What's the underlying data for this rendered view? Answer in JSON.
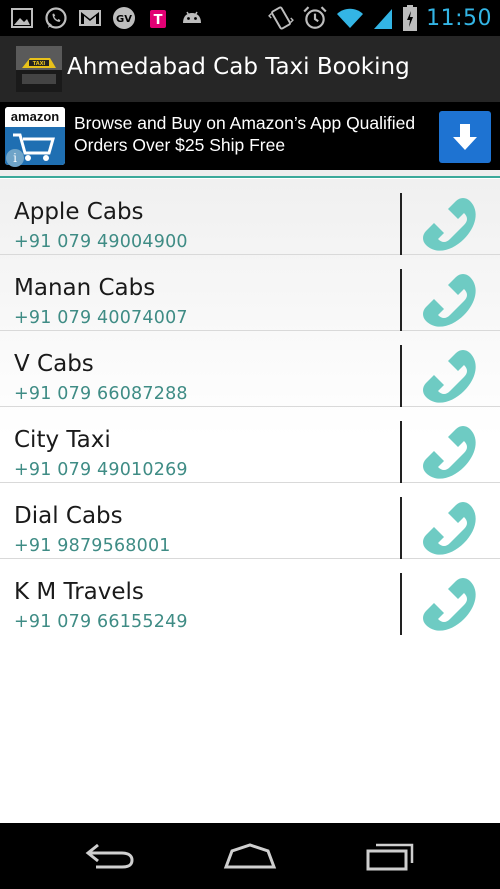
{
  "status_bar": {
    "time": "11:50",
    "left_icons": [
      "picture-icon",
      "whatsapp-icon",
      "gmail-icon",
      "google-voice-icon",
      "tmobile-icon",
      "android-icon"
    ],
    "right_icons": [
      "vibrate-icon",
      "alarm-icon",
      "wifi-icon",
      "signal-icon",
      "battery-icon"
    ],
    "google_voice_label": "GV",
    "tmobile_label": "T"
  },
  "action_bar": {
    "title": "Ahmedabad Cab Taxi Booking",
    "icon": "taxi-icon"
  },
  "ad": {
    "logo_text": "amazon",
    "text": "Browse and Buy on Amazon’s App Qualified Orders Over $25 Ship Free",
    "info_label": "i",
    "button_icon": "download-arrow-icon"
  },
  "contacts": [
    {
      "name": "Apple Cabs",
      "phone": "+91 079 49004900"
    },
    {
      "name": "Manan Cabs",
      "phone": "+91 079 40074007"
    },
    {
      "name": "V Cabs",
      "phone": "+91 079 66087288"
    },
    {
      "name": "City Taxi",
      "phone": "+91 079 49010269"
    },
    {
      "name": "Dial Cabs",
      "phone": "+91 9879568001"
    },
    {
      "name": "K M Travels",
      "phone": "+91 079 66155249"
    }
  ],
  "nav_bar": {
    "buttons": [
      "back-icon",
      "home-icon",
      "recent-apps-icon"
    ]
  },
  "colors": {
    "accent": "#33b5e5",
    "phone_text": "#3f8c85",
    "call_icon": "#6ecbc3",
    "divider": "#3aa99a",
    "ad_button": "#1e73d2"
  }
}
